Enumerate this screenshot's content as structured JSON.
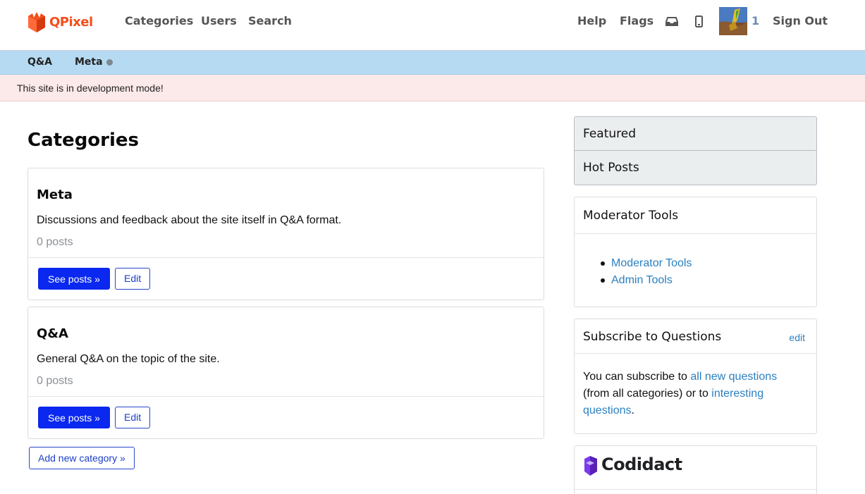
{
  "header": {
    "logo_text": "QPixel",
    "nav": [
      "Categories",
      "Users",
      "Search"
    ],
    "right": {
      "help": "Help",
      "flags": "Flags",
      "reputation": "1",
      "sign_out": "Sign Out"
    },
    "icons": [
      "inbox-icon",
      "mobile-icon"
    ],
    "colors": {
      "logo": "#f44e1c",
      "nav_text": "#555555",
      "reputation": "#6c8bb0"
    }
  },
  "category_bar": {
    "items": [
      "Q&A",
      "Meta"
    ],
    "color": "#b5daf1"
  },
  "notice": {
    "text": "This site is in development mode!",
    "color": "#fce9e9"
  },
  "main": {
    "title": "Categories",
    "categories": [
      {
        "name": "Meta",
        "description": "Discussions and feedback about the site itself in Q&A format.",
        "count": "0 posts",
        "see_posts": "See posts »",
        "edit": "Edit"
      },
      {
        "name": "Q&A",
        "description": "General Q&A on the topic of the site.",
        "count": "0 posts",
        "see_posts": "See posts »",
        "edit": "Edit"
      }
    ],
    "add_category": "Add new category »",
    "colors": {
      "primary_button": "#0a28ef"
    }
  },
  "sidebar": {
    "tabs": [
      "Featured",
      "Hot Posts"
    ],
    "moderator": {
      "title": "Moderator Tools",
      "links": [
        "Moderator Tools",
        "Admin Tools"
      ]
    },
    "subscribe": {
      "title": "Subscribe to Questions",
      "edit": "edit",
      "text_1": "You can subscribe to ",
      "link_1": "all new questions",
      "text_2": " (from all categories) or to ",
      "link_2": "interesting questions",
      "text_3": "."
    },
    "brand": "Codidact",
    "colors": {
      "link": "#2b80c0"
    }
  }
}
